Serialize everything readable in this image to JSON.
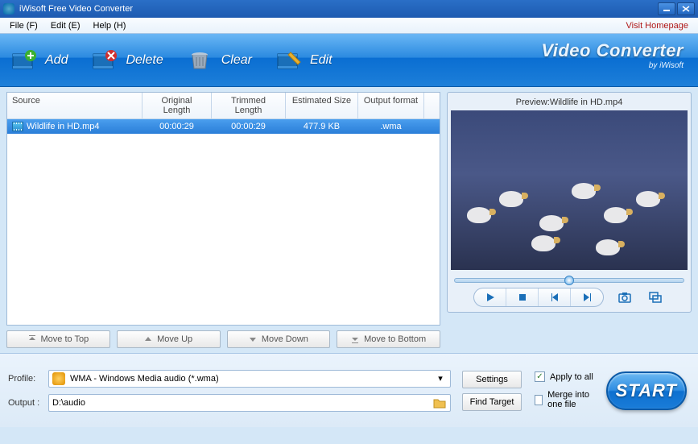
{
  "window": {
    "title": "iWisoft Free Video Converter"
  },
  "menu": {
    "file": "File (F)",
    "edit": "Edit (E)",
    "help": "Help (H)",
    "visit": "Visit Homepage"
  },
  "toolbar": {
    "add": "Add",
    "delete": "Delete",
    "clear": "Clear",
    "edit": "Edit"
  },
  "brand": {
    "title": "Video Converter",
    "sub": "by iWisoft"
  },
  "table": {
    "headers": {
      "source": "Source",
      "orig": "Original Length",
      "trim": "Trimmed Length",
      "size": "Estimated Size",
      "fmt": "Output format"
    },
    "rows": [
      {
        "name": "Wildlife in HD.mp4",
        "orig": "00:00:29",
        "trim": "00:00:29",
        "size": "477.9 KB",
        "fmt": ".wma"
      }
    ]
  },
  "movebtns": {
    "top": "Move to Top",
    "up": "Move Up",
    "down": "Move Down",
    "bottom": "Move to Bottom"
  },
  "preview": {
    "title": "Preview:Wildlife in HD.mp4"
  },
  "bottom": {
    "profile_label": "Profile:",
    "profile_value": "WMA - Windows Media audio (*.wma)",
    "output_label": "Output :",
    "output_value": "D:\\audio",
    "settings": "Settings",
    "findtarget": "Find Target",
    "apply": "Apply to all",
    "merge": "Merge into one file",
    "start": "START"
  }
}
